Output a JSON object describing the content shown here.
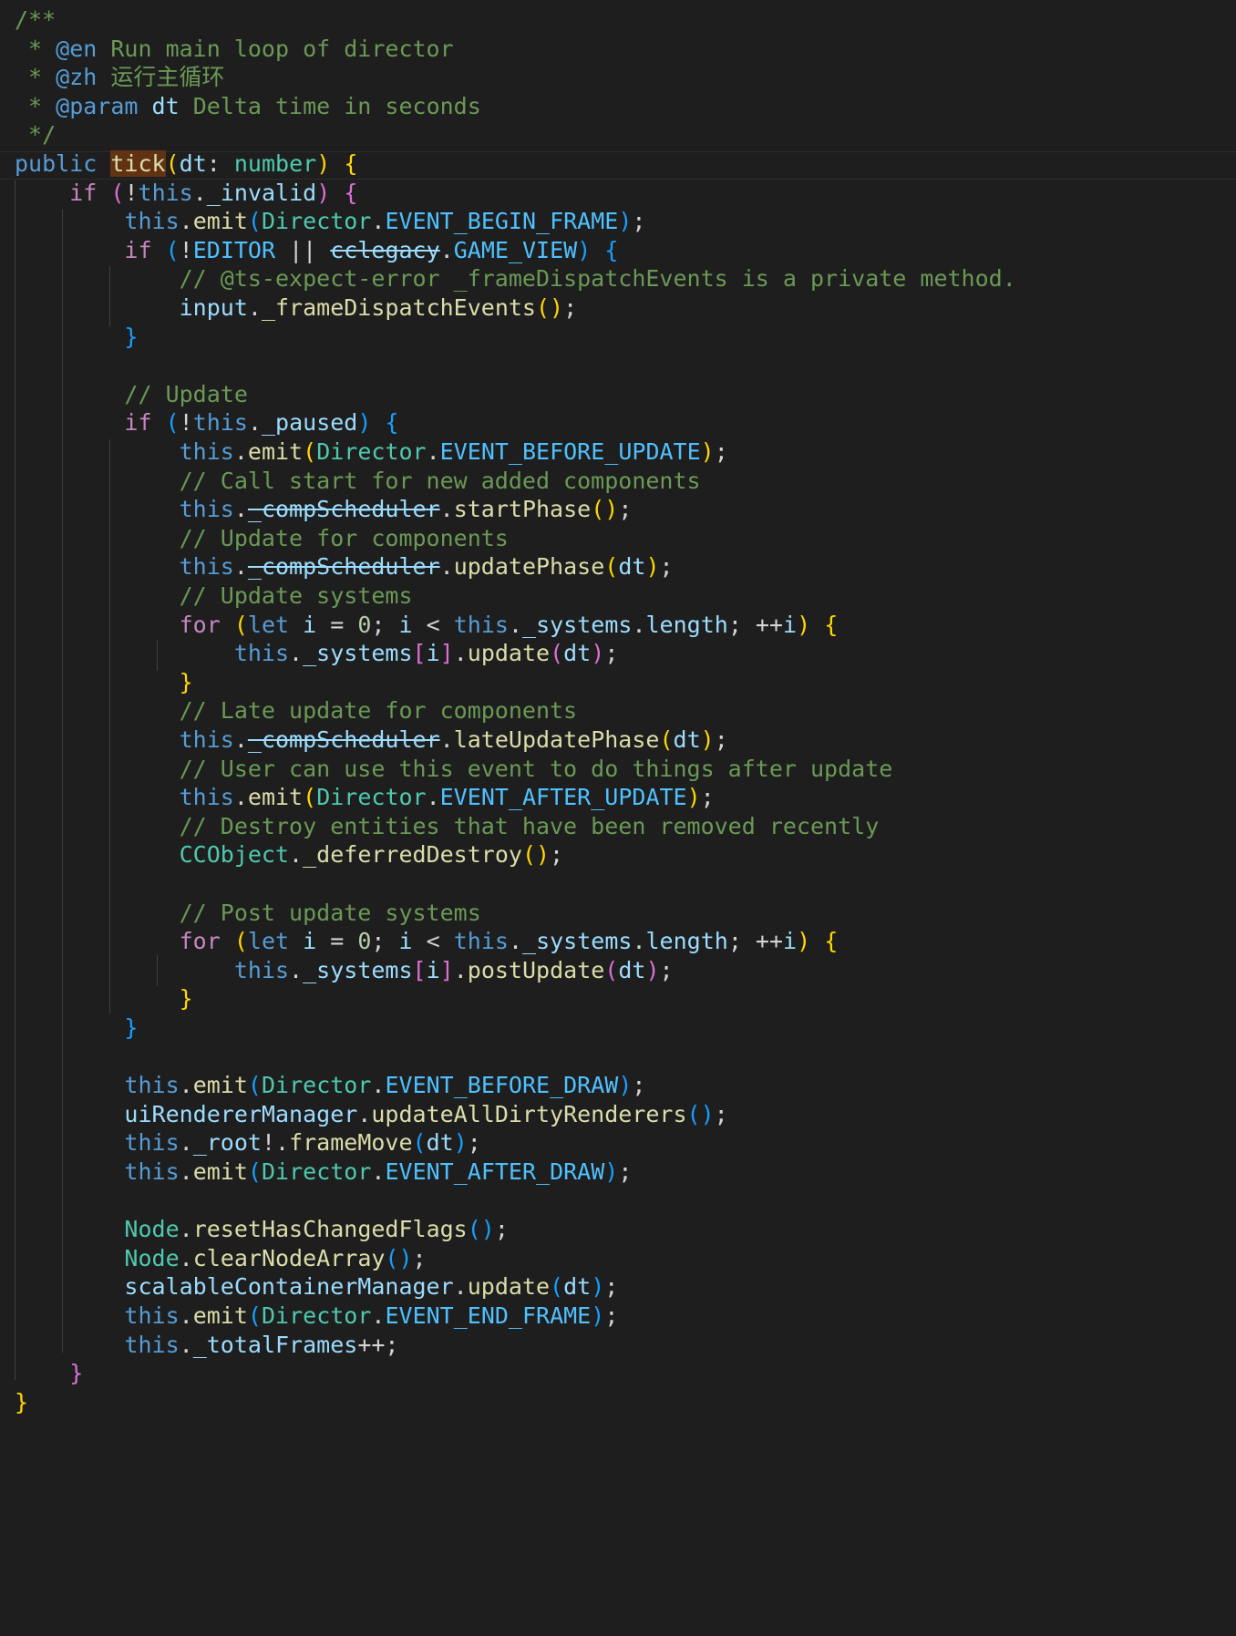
{
  "editor": {
    "language": "typescript",
    "colors": {
      "background": "#1e1e1e",
      "comment": "#6a9955",
      "keyword": "#569cd6",
      "control": "#c586c0",
      "function": "#dcdcaa",
      "variable": "#9cdcfe",
      "type": "#4ec9b0",
      "constant": "#4fc1ff",
      "number": "#b5cea8",
      "bracket_1": "#ffd700",
      "bracket_2": "#da70d6",
      "bracket_3": "#179fff",
      "selection_highlight": "#613214"
    }
  },
  "code": {
    "lines": [
      [
        [
          "cmt",
          "/**"
        ]
      ],
      [
        [
          "cmt",
          " * "
        ],
        [
          "doctag",
          "@en"
        ],
        [
          "cmt",
          " Run main loop of director"
        ]
      ],
      [
        [
          "cmt",
          " * "
        ],
        [
          "doctag",
          "@zh"
        ],
        [
          "cmt",
          " 运行主循环"
        ]
      ],
      [
        [
          "cmt",
          " * "
        ],
        [
          "doctag",
          "@param"
        ],
        [
          "cmt",
          " "
        ],
        [
          "var",
          "dt"
        ],
        [
          "cmt",
          " Delta time in seconds"
        ]
      ],
      [
        [
          "cmt",
          " */"
        ]
      ],
      [
        [
          "kw",
          "public"
        ],
        [
          "op",
          " "
        ],
        [
          "fn tickhl",
          "tick"
        ],
        [
          "p1",
          "("
        ],
        [
          "var",
          "dt"
        ],
        [
          "op",
          ": "
        ],
        [
          "typ",
          "number"
        ],
        [
          "p1",
          ")"
        ],
        [
          "op",
          " "
        ],
        [
          "p1",
          "{"
        ]
      ],
      [
        [
          "op",
          "    "
        ],
        [
          "ctl",
          "if"
        ],
        [
          "op",
          " "
        ],
        [
          "p2",
          "("
        ],
        [
          "op",
          "!"
        ],
        [
          "kw",
          "this"
        ],
        [
          "op",
          "."
        ],
        [
          "prop",
          "_invalid"
        ],
        [
          "p2",
          ")"
        ],
        [
          "op",
          " "
        ],
        [
          "p2",
          "{"
        ]
      ],
      [
        [
          "op",
          "        "
        ],
        [
          "kw",
          "this"
        ],
        [
          "op",
          "."
        ],
        [
          "fn",
          "emit"
        ],
        [
          "p3",
          "("
        ],
        [
          "cls",
          "Director"
        ],
        [
          "op",
          "."
        ],
        [
          "const",
          "EVENT_BEGIN_FRAME"
        ],
        [
          "p3",
          ")"
        ],
        [
          "op",
          ";"
        ]
      ],
      [
        [
          "op",
          "        "
        ],
        [
          "ctl",
          "if"
        ],
        [
          "op",
          " "
        ],
        [
          "p3",
          "("
        ],
        [
          "op",
          "!"
        ],
        [
          "const",
          "EDITOR"
        ],
        [
          "op",
          " || "
        ],
        [
          "var dep",
          "cclegacy"
        ],
        [
          "op",
          "."
        ],
        [
          "const",
          "GAME_VIEW"
        ],
        [
          "p3",
          ")"
        ],
        [
          "op",
          " "
        ],
        [
          "p3",
          "{"
        ]
      ],
      [
        [
          "op",
          "            "
        ],
        [
          "cmt",
          "// @ts-expect-error _frameDispatchEvents is a private method."
        ]
      ],
      [
        [
          "op",
          "            "
        ],
        [
          "var",
          "input"
        ],
        [
          "op",
          "."
        ],
        [
          "fn",
          "_frameDispatchEvents"
        ],
        [
          "p1",
          "()"
        ],
        [
          "op",
          ";"
        ]
      ],
      [
        [
          "op",
          "        "
        ],
        [
          "p3",
          "}"
        ]
      ],
      [],
      [
        [
          "op",
          "        "
        ],
        [
          "cmt",
          "// Update"
        ]
      ],
      [
        [
          "op",
          "        "
        ],
        [
          "ctl",
          "if"
        ],
        [
          "op",
          " "
        ],
        [
          "p3",
          "("
        ],
        [
          "op",
          "!"
        ],
        [
          "kw",
          "this"
        ],
        [
          "op",
          "."
        ],
        [
          "prop",
          "_paused"
        ],
        [
          "p3",
          ")"
        ],
        [
          "op",
          " "
        ],
        [
          "p3",
          "{"
        ]
      ],
      [
        [
          "op",
          "            "
        ],
        [
          "kw",
          "this"
        ],
        [
          "op",
          "."
        ],
        [
          "fn",
          "emit"
        ],
        [
          "p1",
          "("
        ],
        [
          "cls",
          "Director"
        ],
        [
          "op",
          "."
        ],
        [
          "const",
          "EVENT_BEFORE_UPDATE"
        ],
        [
          "p1",
          ")"
        ],
        [
          "op",
          ";"
        ]
      ],
      [
        [
          "op",
          "            "
        ],
        [
          "cmt",
          "// Call start for new added components"
        ]
      ],
      [
        [
          "op",
          "            "
        ],
        [
          "kw",
          "this"
        ],
        [
          "op",
          "."
        ],
        [
          "prop dep",
          "_compScheduler"
        ],
        [
          "op",
          "."
        ],
        [
          "fn",
          "startPhase"
        ],
        [
          "p1",
          "()"
        ],
        [
          "op",
          ";"
        ]
      ],
      [
        [
          "op",
          "            "
        ],
        [
          "cmt",
          "// Update for components"
        ]
      ],
      [
        [
          "op",
          "            "
        ],
        [
          "kw",
          "this"
        ],
        [
          "op",
          "."
        ],
        [
          "prop dep",
          "_compScheduler"
        ],
        [
          "op",
          "."
        ],
        [
          "fn",
          "updatePhase"
        ],
        [
          "p1",
          "("
        ],
        [
          "var",
          "dt"
        ],
        [
          "p1",
          ")"
        ],
        [
          "op",
          ";"
        ]
      ],
      [
        [
          "op",
          "            "
        ],
        [
          "cmt",
          "// Update systems"
        ]
      ],
      [
        [
          "op",
          "            "
        ],
        [
          "ctl",
          "for"
        ],
        [
          "op",
          " "
        ],
        [
          "p1",
          "("
        ],
        [
          "kw",
          "let"
        ],
        [
          "op",
          " "
        ],
        [
          "var",
          "i"
        ],
        [
          "op",
          " = "
        ],
        [
          "num",
          "0"
        ],
        [
          "op",
          "; "
        ],
        [
          "var",
          "i"
        ],
        [
          "op",
          " < "
        ],
        [
          "kw",
          "this"
        ],
        [
          "op",
          "."
        ],
        [
          "prop",
          "_systems"
        ],
        [
          "op",
          "."
        ],
        [
          "prop",
          "length"
        ],
        [
          "op",
          "; ++"
        ],
        [
          "var",
          "i"
        ],
        [
          "p1",
          ")"
        ],
        [
          "op",
          " "
        ],
        [
          "p1",
          "{"
        ]
      ],
      [
        [
          "op",
          "                "
        ],
        [
          "kw",
          "this"
        ],
        [
          "op",
          "."
        ],
        [
          "prop",
          "_systems"
        ],
        [
          "p2",
          "["
        ],
        [
          "var",
          "i"
        ],
        [
          "p2",
          "]"
        ],
        [
          "op",
          "."
        ],
        [
          "fn",
          "update"
        ],
        [
          "p2",
          "("
        ],
        [
          "var",
          "dt"
        ],
        [
          "p2",
          ")"
        ],
        [
          "op",
          ";"
        ]
      ],
      [
        [
          "op",
          "            "
        ],
        [
          "p1",
          "}"
        ]
      ],
      [
        [
          "op",
          "            "
        ],
        [
          "cmt",
          "// Late update for components"
        ]
      ],
      [
        [
          "op",
          "            "
        ],
        [
          "kw",
          "this"
        ],
        [
          "op",
          "."
        ],
        [
          "prop dep",
          "_compScheduler"
        ],
        [
          "op",
          "."
        ],
        [
          "fn",
          "lateUpdatePhase"
        ],
        [
          "p1",
          "("
        ],
        [
          "var",
          "dt"
        ],
        [
          "p1",
          ")"
        ],
        [
          "op",
          ";"
        ]
      ],
      [
        [
          "op",
          "            "
        ],
        [
          "cmt",
          "// User can use this event to do things after update"
        ]
      ],
      [
        [
          "op",
          "            "
        ],
        [
          "kw",
          "this"
        ],
        [
          "op",
          "."
        ],
        [
          "fn",
          "emit"
        ],
        [
          "p1",
          "("
        ],
        [
          "cls",
          "Director"
        ],
        [
          "op",
          "."
        ],
        [
          "const",
          "EVENT_AFTER_UPDATE"
        ],
        [
          "p1",
          ")"
        ],
        [
          "op",
          ";"
        ]
      ],
      [
        [
          "op",
          "            "
        ],
        [
          "cmt",
          "// Destroy entities that have been removed recently"
        ]
      ],
      [
        [
          "op",
          "            "
        ],
        [
          "cls",
          "CCObject"
        ],
        [
          "op",
          "."
        ],
        [
          "fn",
          "_deferredDestroy"
        ],
        [
          "p1",
          "()"
        ],
        [
          "op",
          ";"
        ]
      ],
      [],
      [
        [
          "op",
          "            "
        ],
        [
          "cmt",
          "// Post update systems"
        ]
      ],
      [
        [
          "op",
          "            "
        ],
        [
          "ctl",
          "for"
        ],
        [
          "op",
          " "
        ],
        [
          "p1",
          "("
        ],
        [
          "kw",
          "let"
        ],
        [
          "op",
          " "
        ],
        [
          "var",
          "i"
        ],
        [
          "op",
          " = "
        ],
        [
          "num",
          "0"
        ],
        [
          "op",
          "; "
        ],
        [
          "var",
          "i"
        ],
        [
          "op",
          " < "
        ],
        [
          "kw",
          "this"
        ],
        [
          "op",
          "."
        ],
        [
          "prop",
          "_systems"
        ],
        [
          "op",
          "."
        ],
        [
          "prop",
          "length"
        ],
        [
          "op",
          "; ++"
        ],
        [
          "var",
          "i"
        ],
        [
          "p1",
          ")"
        ],
        [
          "op",
          " "
        ],
        [
          "p1",
          "{"
        ]
      ],
      [
        [
          "op",
          "                "
        ],
        [
          "kw",
          "this"
        ],
        [
          "op",
          "."
        ],
        [
          "prop",
          "_systems"
        ],
        [
          "p2",
          "["
        ],
        [
          "var",
          "i"
        ],
        [
          "p2",
          "]"
        ],
        [
          "op",
          "."
        ],
        [
          "fn",
          "postUpdate"
        ],
        [
          "p2",
          "("
        ],
        [
          "var",
          "dt"
        ],
        [
          "p2",
          ")"
        ],
        [
          "op",
          ";"
        ]
      ],
      [
        [
          "op",
          "            "
        ],
        [
          "p1",
          "}"
        ]
      ],
      [
        [
          "op",
          "        "
        ],
        [
          "p3",
          "}"
        ]
      ],
      [],
      [
        [
          "op",
          "        "
        ],
        [
          "kw",
          "this"
        ],
        [
          "op",
          "."
        ],
        [
          "fn",
          "emit"
        ],
        [
          "p3",
          "("
        ],
        [
          "cls",
          "Director"
        ],
        [
          "op",
          "."
        ],
        [
          "const",
          "EVENT_BEFORE_DRAW"
        ],
        [
          "p3",
          ")"
        ],
        [
          "op",
          ";"
        ]
      ],
      [
        [
          "op",
          "        "
        ],
        [
          "var",
          "uiRendererManager"
        ],
        [
          "op",
          "."
        ],
        [
          "fn",
          "updateAllDirtyRenderers"
        ],
        [
          "p3",
          "()"
        ],
        [
          "op",
          ";"
        ]
      ],
      [
        [
          "op",
          "        "
        ],
        [
          "kw",
          "this"
        ],
        [
          "op",
          "."
        ],
        [
          "prop",
          "_root"
        ],
        [
          "op",
          "!."
        ],
        [
          "fn",
          "frameMove"
        ],
        [
          "p3",
          "("
        ],
        [
          "var",
          "dt"
        ],
        [
          "p3",
          ")"
        ],
        [
          "op",
          ";"
        ]
      ],
      [
        [
          "op",
          "        "
        ],
        [
          "kw",
          "this"
        ],
        [
          "op",
          "."
        ],
        [
          "fn",
          "emit"
        ],
        [
          "p3",
          "("
        ],
        [
          "cls",
          "Director"
        ],
        [
          "op",
          "."
        ],
        [
          "const",
          "EVENT_AFTER_DRAW"
        ],
        [
          "p3",
          ")"
        ],
        [
          "op",
          ";"
        ]
      ],
      [],
      [
        [
          "op",
          "        "
        ],
        [
          "cls",
          "Node"
        ],
        [
          "op",
          "."
        ],
        [
          "fn",
          "resetHasChangedFlags"
        ],
        [
          "p3",
          "()"
        ],
        [
          "op",
          ";"
        ]
      ],
      [
        [
          "op",
          "        "
        ],
        [
          "cls",
          "Node"
        ],
        [
          "op",
          "."
        ],
        [
          "fn",
          "clearNodeArray"
        ],
        [
          "p3",
          "()"
        ],
        [
          "op",
          ";"
        ]
      ],
      [
        [
          "op",
          "        "
        ],
        [
          "var",
          "scalableContainerManager"
        ],
        [
          "op",
          "."
        ],
        [
          "fn",
          "update"
        ],
        [
          "p3",
          "("
        ],
        [
          "var",
          "dt"
        ],
        [
          "p3",
          ")"
        ],
        [
          "op",
          ";"
        ]
      ],
      [
        [
          "op",
          "        "
        ],
        [
          "kw",
          "this"
        ],
        [
          "op",
          "."
        ],
        [
          "fn",
          "emit"
        ],
        [
          "p3",
          "("
        ],
        [
          "cls",
          "Director"
        ],
        [
          "op",
          "."
        ],
        [
          "const",
          "EVENT_END_FRAME"
        ],
        [
          "p3",
          ")"
        ],
        [
          "op",
          ";"
        ]
      ],
      [
        [
          "op",
          "        "
        ],
        [
          "kw",
          "this"
        ],
        [
          "op",
          "."
        ],
        [
          "prop",
          "_totalFrames"
        ],
        [
          "op",
          "++;"
        ]
      ],
      [
        [
          "op",
          "    "
        ],
        [
          "p2",
          "}"
        ]
      ],
      [
        [
          "p1",
          "}"
        ]
      ]
    ]
  }
}
